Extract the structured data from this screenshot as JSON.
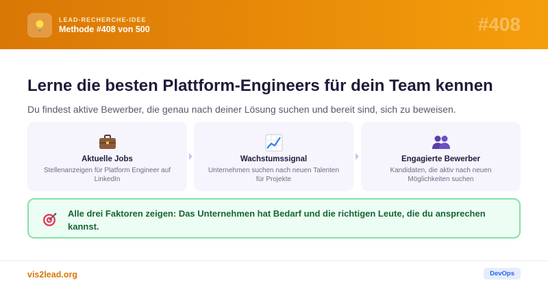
{
  "header": {
    "eyebrow": "LEAD-RECHERCHE-IDEE",
    "method": "Methode #408 von 500",
    "number": "#408",
    "icon": "lightbulb-icon"
  },
  "main": {
    "title": "Lerne die besten Plattform-Engineers für dein Team kennen",
    "subtitle": "Du findest aktive Bewerber, die genau nach deiner Lösung suchen und bereit sind, sich zu beweisen."
  },
  "cards": [
    {
      "icon": "briefcase-icon",
      "title": "Aktuelle Jobs",
      "description": "Stellenanzeigen für Platform Engineer auf LinkedIn"
    },
    {
      "icon": "chart-increasing-icon",
      "title": "Wachstumssignal",
      "description": "Unternehmen suchen nach neuen Talenten für Projekte"
    },
    {
      "icon": "people-icon",
      "title": "Engagierte Bewerber",
      "description": "Kandidaten, die aktiv nach neuen Möglichkeiten suchen"
    }
  ],
  "callout": {
    "icon": "target-icon",
    "text": "Alle drei Faktoren zeigen: Das Unternehmen hat Bedarf und die richtigen Leute, die du ansprechen kannst."
  },
  "footer": {
    "brand": "vis2lead.org",
    "tag": "DevOps"
  },
  "colors": {
    "header_start": "#d97706",
    "header_end": "#f59e0b",
    "callout_bg": "#ecfdf3",
    "callout_border": "#86e0a8",
    "brand": "#d97706",
    "tag_text": "#2563eb"
  }
}
